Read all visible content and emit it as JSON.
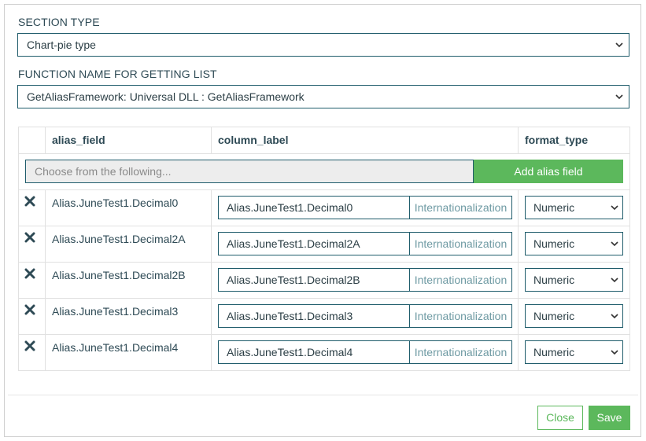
{
  "section_type": {
    "label": "SECTION TYPE",
    "value": "Chart-pie type"
  },
  "function_name": {
    "label": "FUNCTION NAME FOR GETTING LIST",
    "value": "GetAliasFramework: Universal DLL : GetAliasFramework"
  },
  "table": {
    "headers": {
      "alias_field": "alias_field",
      "column_label": "column_label",
      "format_type": "format_type"
    },
    "choose_placeholder": "Choose from the following...",
    "add_button": "Add alias field",
    "rows": [
      {
        "alias": "Alias.JuneTest1.Decimal0",
        "column_label": "Alias.JuneTest1.Decimal0",
        "i18n": "Internationalization",
        "format": "Numeric"
      },
      {
        "alias": "Alias.JuneTest1.Decimal2A",
        "column_label": "Alias.JuneTest1.Decimal2A",
        "i18n": "Internationalization",
        "format": "Numeric"
      },
      {
        "alias": "Alias.JuneTest1.Decimal2B",
        "column_label": "Alias.JuneTest1.Decimal2B",
        "i18n": "Internationalization",
        "format": "Numeric"
      },
      {
        "alias": "Alias.JuneTest1.Decimal3",
        "column_label": "Alias.JuneTest1.Decimal3",
        "i18n": "Internationalization",
        "format": "Numeric"
      },
      {
        "alias": "Alias.JuneTest1.Decimal4",
        "column_label": "Alias.JuneTest1.Decimal4",
        "i18n": "Internationalization",
        "format": "Numeric"
      }
    ],
    "delete_icon": "close-x-icon"
  },
  "footer": {
    "close_label": "Close",
    "save_label": "Save"
  },
  "colors": {
    "accent_green": "#5cb85c",
    "border_teal": "#1f5c6b",
    "text_dark": "#2e4a55",
    "link_muted": "#6e9aa3"
  }
}
